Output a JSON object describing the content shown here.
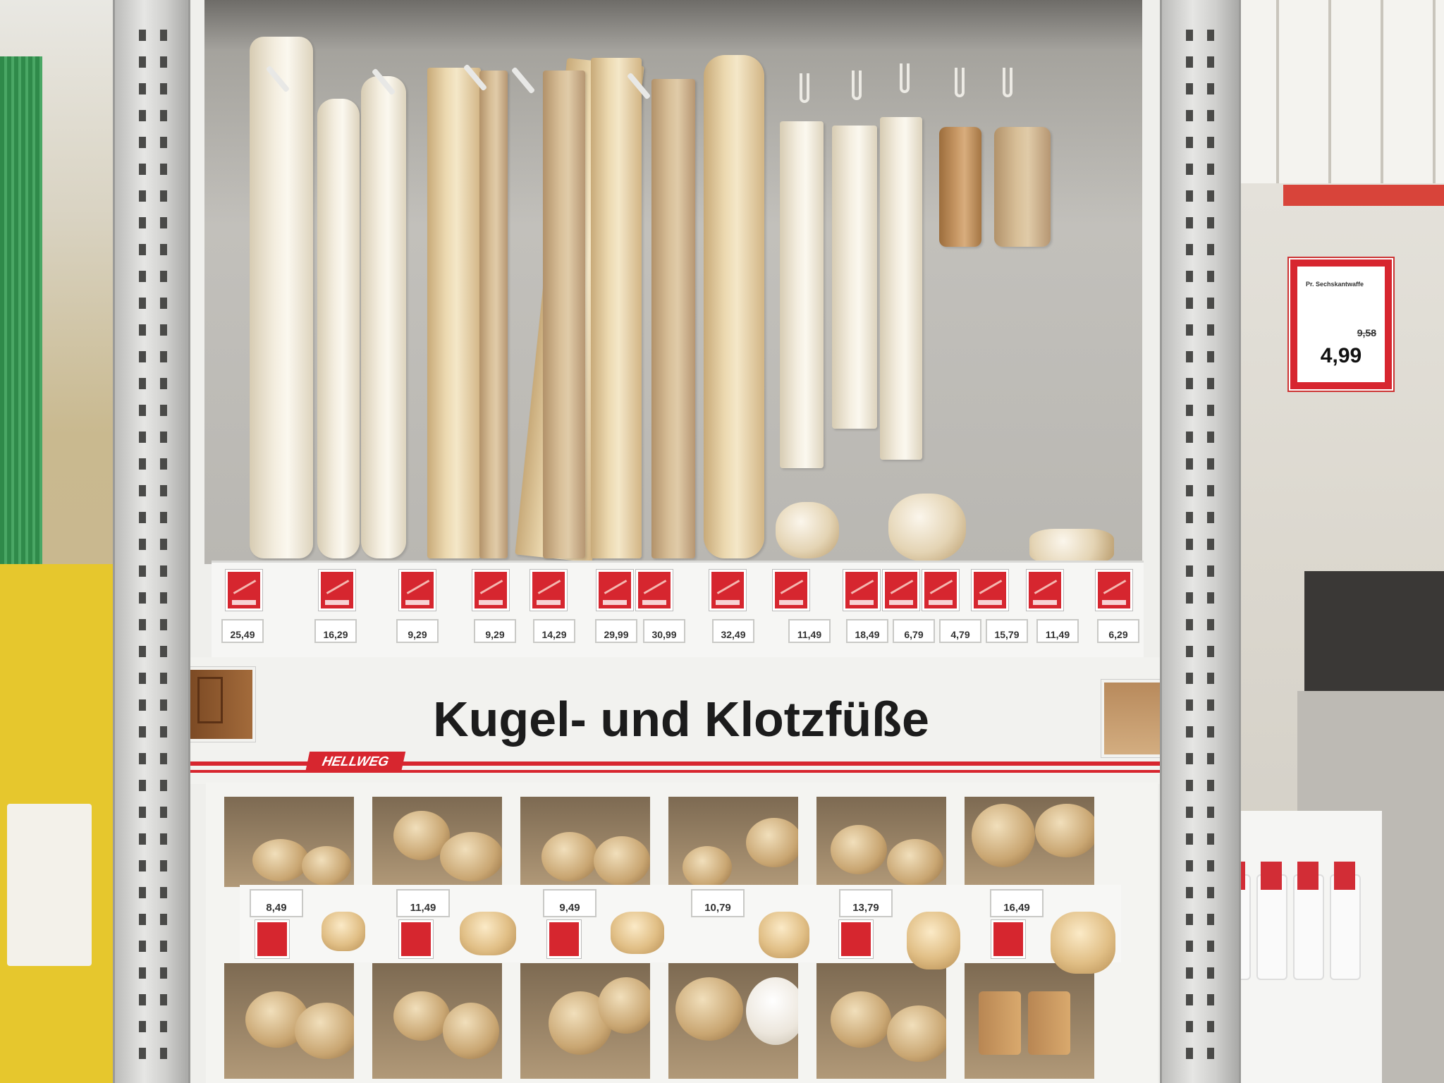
{
  "banner": {
    "title": "Kugel- und Klotzfüße",
    "brand": "HELLWEG"
  },
  "upper_prices": [
    "25,49",
    "16,29",
    "9,29",
    "9,29",
    "14,29",
    "29,99",
    "30,99",
    "32,49",
    "11,49",
    "18,49",
    "6,79",
    "4,79",
    "15,79",
    "11,49",
    "6,29"
  ],
  "lower_prices": [
    "8,49",
    "11,49",
    "9,49",
    "10,79",
    "13,79",
    "16,49"
  ],
  "sign": {
    "name": "Pr. Sechskantwaffe",
    "old_price": "9,58",
    "new_price": "4,99"
  },
  "colors": {
    "brand_red": "#d7262f",
    "wood": "#ecd9b0"
  }
}
